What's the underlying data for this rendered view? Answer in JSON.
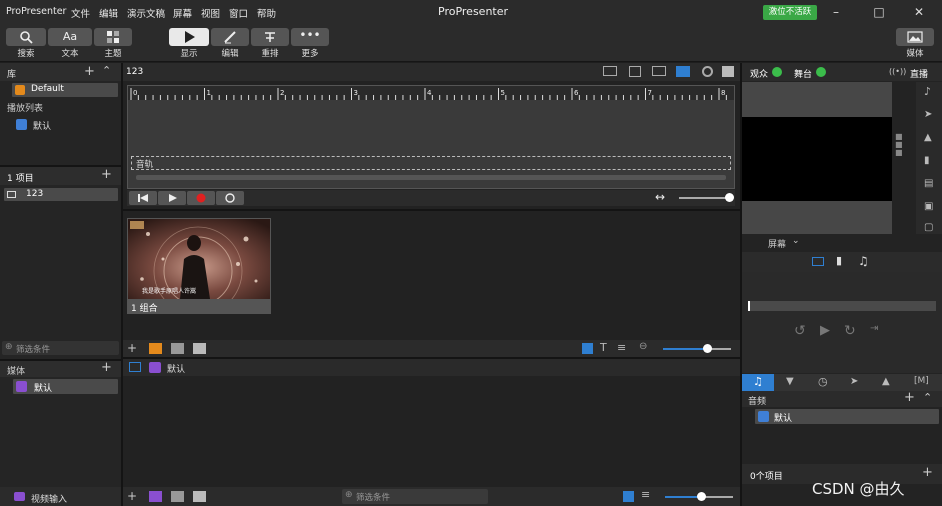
{
  "menubar": {
    "items": [
      "ProPresenter",
      "文件",
      "编辑",
      "演示文稿",
      "屏幕",
      "视图",
      "窗口",
      "帮助"
    ],
    "title": "ProPresenter",
    "badge": "激位不活跃"
  },
  "toolbar": {
    "search": "搜索",
    "text": "文本",
    "theme": "主题",
    "show": "显示",
    "edit": "编辑",
    "reflow": "重排",
    "more": "更多",
    "media": "媒体"
  },
  "library": {
    "header": "库",
    "default_item": "Default",
    "playlist_header": "播放列表",
    "playlist_item": "默认"
  },
  "items_panel": {
    "header": "1 项目",
    "item": "123"
  },
  "filter": {
    "left": "筛选条件",
    "bottom": "筛选条件"
  },
  "media_panel": {
    "header": "媒体",
    "item": "默认",
    "video_input": "视频输入"
  },
  "presentation": {
    "title": "123",
    "track_label": "音轨",
    "ruler_ticks": [
      "0",
      "1",
      "2",
      "3",
      "4",
      "5",
      "6",
      "7",
      "8"
    ],
    "slide_label": "1  组合",
    "slide_caption": "我是歌手原唱人许嵩",
    "playlist_row": "默认"
  },
  "right": {
    "audience": "观众",
    "stage": "舞台",
    "live": "直播",
    "screen_dropdown": "屏幕",
    "audio_header": "音频",
    "audio_item": "默认",
    "item_count": "0个项目"
  },
  "watermark": "CSDN @由久",
  "colors": {
    "accent_blue": "#2f7fd1",
    "green_status": "#3bbd4b",
    "record_red": "#e02020",
    "activate_green": "#3aa846"
  }
}
